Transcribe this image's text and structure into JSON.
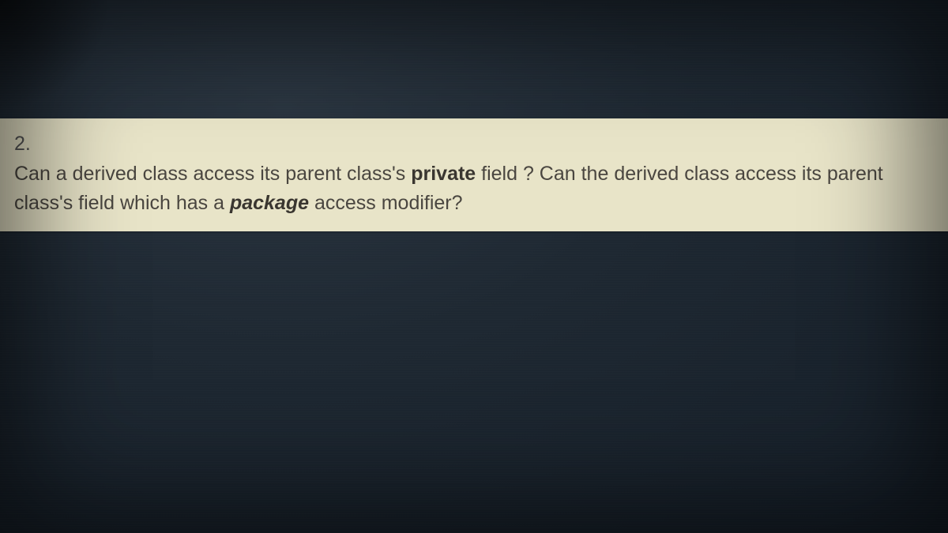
{
  "question": {
    "number": "2.",
    "text_part1": "Can a derived class access its parent class's ",
    "term1": "private",
    "text_part2": " field ? Can the derived class access its parent class's field which has a ",
    "term2": "package",
    "text_part3": " access modifier?"
  }
}
